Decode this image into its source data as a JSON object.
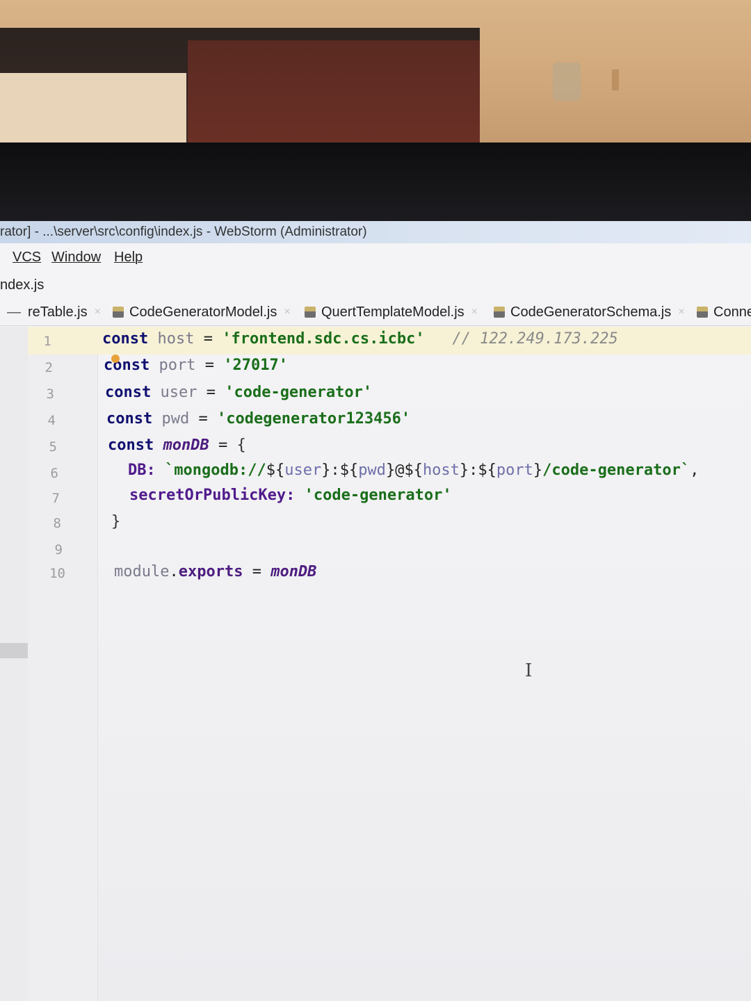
{
  "window": {
    "title": "rator] - ...\\server\\src\\config\\index.js - WebStorm (Administrator)"
  },
  "menu": {
    "items": [
      "VCS",
      "Window",
      "Help"
    ]
  },
  "navbar": {
    "crumb": "ndex.js"
  },
  "tabs": [
    {
      "label": "reTable.js"
    },
    {
      "label": "CodeGeneratorModel.js"
    },
    {
      "label": "QuertTemplateModel.js"
    },
    {
      "label": "CodeGeneratorSchema.js"
    },
    {
      "label": "Conne"
    }
  ],
  "tab_close_glyph": "×",
  "editor": {
    "line_numbers": [
      "1",
      "2",
      "3",
      "4",
      "5",
      "6",
      "7",
      "8",
      "9",
      "10"
    ],
    "lines": {
      "l1": {
        "kw": "const",
        "name": "host",
        "eq": "=",
        "str": "'frontend.sdc.cs.icbc'",
        "comment": "// 122.249.173.225"
      },
      "l2": {
        "kw": "const",
        "name": "port",
        "eq": "=",
        "str": "'27017'"
      },
      "l3": {
        "kw": "const",
        "name": "user",
        "eq": "=",
        "str": "'code-generator'"
      },
      "l4": {
        "kw": "const",
        "name": "pwd",
        "eq": "=",
        "str": "'codegenerator123456'"
      },
      "l5": {
        "kw": "const",
        "name": "monDB",
        "eq": "=",
        "brace": "{"
      },
      "l6": {
        "prop": "DB:",
        "tick_open": "`mongodb://",
        "d1": "${",
        "v1": "user",
        "c1": "}:",
        "d2": "${",
        "v2": "pwd",
        "c2": "}@",
        "d3": "${",
        "v3": "host",
        "c3": "}:",
        "d4": "${",
        "v4": "port",
        "c4": "}",
        "tail": "/code-generator`",
        "comma": ","
      },
      "l7": {
        "prop": "secretOrPublicKey:",
        "str": "'code-generator'"
      },
      "l8": {
        "brace": "}"
      },
      "l10": {
        "mod": "module",
        "dot": ".",
        "exp": "exports",
        "eq": "=",
        "val": "monDB"
      }
    }
  },
  "cursor_glyph": "I"
}
